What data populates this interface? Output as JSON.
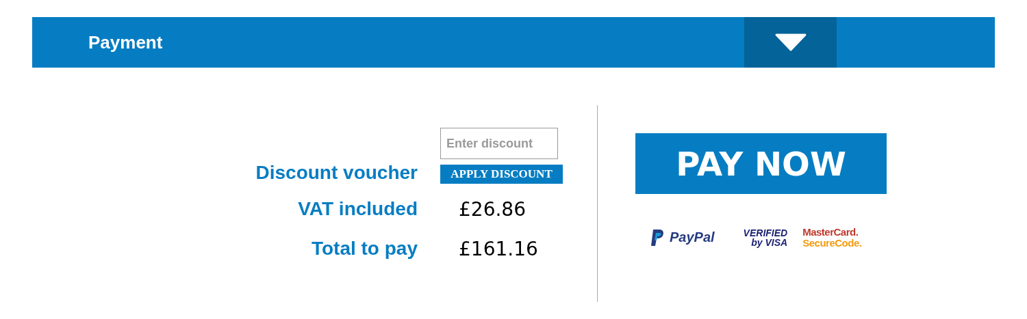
{
  "header": {
    "title": "Payment",
    "expanded": false
  },
  "discount": {
    "label": "Discount voucher",
    "placeholder": "Enter discount",
    "button": "APPLY DISCOUNT"
  },
  "summary": [
    {
      "label": "VAT included",
      "value": "£26.86"
    },
    {
      "label": "Total to pay",
      "value": "£161.16"
    }
  ],
  "pay_button": "PAY NOW",
  "payment_logos": [
    {
      "kind": "paypal",
      "lines": [
        "PayPal"
      ]
    },
    {
      "kind": "visa",
      "lines": [
        "VERIFIED",
        "by VISA"
      ]
    },
    {
      "kind": "mastercard",
      "lines": [
        "MasterCard.",
        "SecureCode."
      ]
    }
  ]
}
